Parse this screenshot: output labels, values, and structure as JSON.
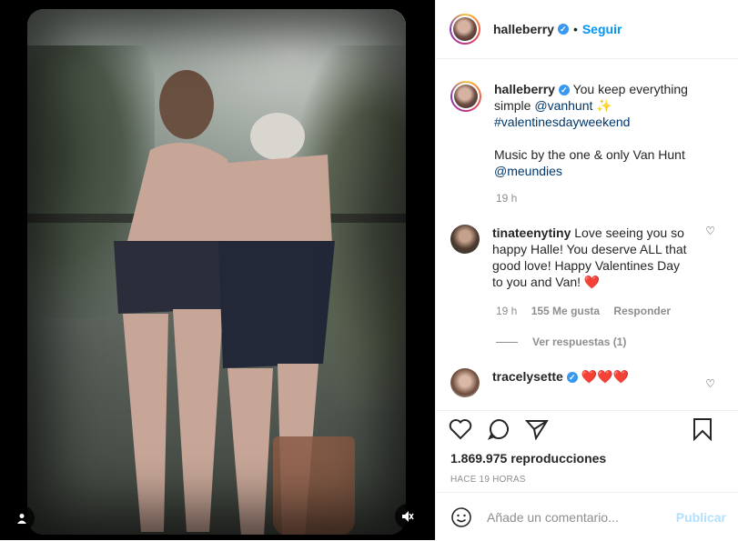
{
  "header": {
    "username": "halleberry",
    "dot": "•",
    "follow": "Seguir"
  },
  "caption": {
    "username": "halleberry",
    "text1": "You keep everything simple",
    "mention1": "@vanhunt",
    "sparkle": "✨",
    "hashtag": "#valentinesdayweekend",
    "text2": "Music by the one & only Van Hunt",
    "mention2": "@meundies",
    "time": "19 h"
  },
  "comments": [
    {
      "username": "tinateenytiny",
      "text": "Love seeing you so happy Halle! You deserve ALL that good love! Happy Valentines Day to you and Van! ❤️",
      "time": "19 h",
      "likes": "155 Me gusta",
      "reply": "Responder",
      "view_replies": "Ver respuestas (1)"
    },
    {
      "username": "tracelysette",
      "text": "❤️❤️❤️"
    }
  ],
  "stats": {
    "views": "1.869.975",
    "views_label": "reproducciones",
    "posted": "HACE 19 HORAS"
  },
  "add_comment": {
    "placeholder": "Añade un comentario...",
    "publish": "Publicar"
  },
  "colors": {
    "accent": "#0095f6",
    "text": "#262626",
    "muted": "#8e8e8e"
  }
}
